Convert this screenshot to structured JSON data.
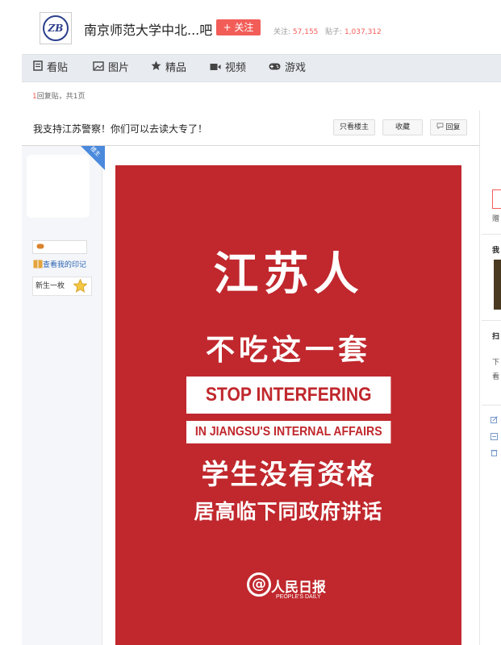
{
  "header": {
    "forum_name": "南京师范大学中北...吧",
    "follow_label": "+ 关注",
    "follow_count_label": "关注:",
    "follow_count": "57,155",
    "post_count_label": "贴子:",
    "post_count": "1,037,312",
    "logo_text": "ZB"
  },
  "nav": {
    "items": [
      {
        "label": "看贴",
        "icon": "doc-icon"
      },
      {
        "label": "图片",
        "icon": "image-icon"
      },
      {
        "label": "精品",
        "icon": "star-icon"
      },
      {
        "label": "视频",
        "icon": "video-icon"
      },
      {
        "label": "游戏",
        "icon": "gamepad-icon"
      }
    ]
  },
  "pager": {
    "reply_count": "1",
    "text": "回复贴，共1页"
  },
  "thread": {
    "title": "我支持江苏警察！你们可以去读大专了！",
    "only_op_label": "只看楼主",
    "favorite_label": "收藏",
    "reply_label": "回复"
  },
  "author": {
    "op_tag": "楼主",
    "diary_label": "查看我的印记",
    "badge_label": "新生一枚"
  },
  "poster": {
    "line1": "江苏人",
    "line2": "不吃这一套",
    "box1": "STOP INTERFERING",
    "box2": "IN JIANGSU'S INTERNAL AFFAIRS",
    "line3": "学生没有资格",
    "line4": "居高临下同政府讲话",
    "logo_cn": "人民日报",
    "logo_en": "PEOPLE'S DAILY",
    "background_color": "#c0282d"
  },
  "sidebar": {
    "frag1": "赠",
    "frag2": "我",
    "frag3": "扫",
    "frag4": "下",
    "frag5": "看"
  },
  "colors": {
    "accent": "#f25d58",
    "link": "#2d64b3",
    "nav_bg": "#e8ebef"
  }
}
